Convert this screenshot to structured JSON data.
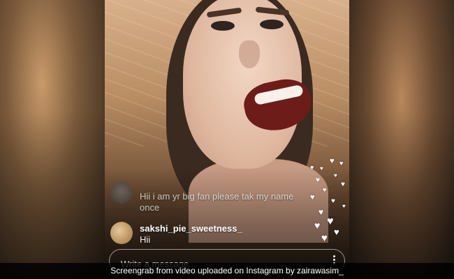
{
  "stream": {
    "comments": [
      {
        "username": "",
        "text": "Hii i am yr big fan please tak my name once"
      },
      {
        "username": "sakshi_pie_sweetness_",
        "text": "Hii"
      }
    ],
    "input": {
      "placeholder": "Write a message..."
    },
    "reactions": {
      "icon": "heart-icon",
      "color": "#ffffff"
    }
  },
  "caption": {
    "text": "Screengrab from video uploaded on Instagram by zairawasim_"
  }
}
